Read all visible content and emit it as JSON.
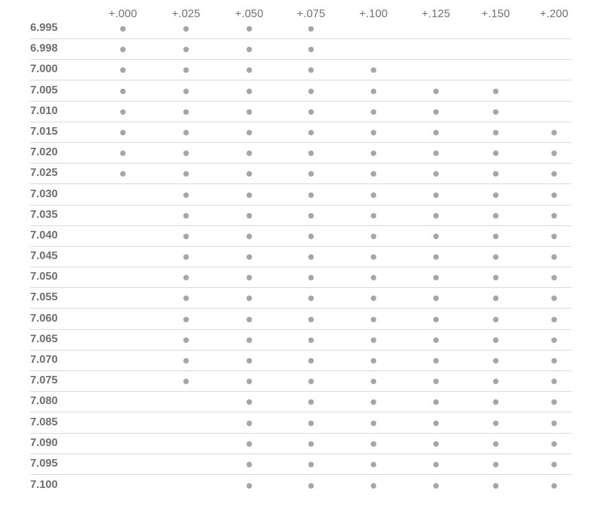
{
  "table": {
    "columns": [
      "+.000",
      "+.025",
      "+.050",
      "+.075",
      "+.100",
      "+.125",
      "+.150",
      "+.200"
    ],
    "dot_color": "#a6a6a6",
    "rows": [
      {
        "label": "6.995",
        "available": [
          true,
          true,
          true,
          true,
          false,
          false,
          false,
          false
        ]
      },
      {
        "label": "6.998",
        "available": [
          true,
          true,
          true,
          true,
          false,
          false,
          false,
          false
        ]
      },
      {
        "label": "7.000",
        "available": [
          true,
          true,
          true,
          true,
          true,
          false,
          false,
          false
        ]
      },
      {
        "label": "7.005",
        "available": [
          true,
          true,
          true,
          true,
          true,
          true,
          true,
          false
        ]
      },
      {
        "label": "7.010",
        "available": [
          true,
          true,
          true,
          true,
          true,
          true,
          true,
          false
        ]
      },
      {
        "label": "7.015",
        "available": [
          true,
          true,
          true,
          true,
          true,
          true,
          true,
          true
        ]
      },
      {
        "label": "7.020",
        "available": [
          true,
          true,
          true,
          true,
          true,
          true,
          true,
          true
        ]
      },
      {
        "label": "7.025",
        "available": [
          true,
          true,
          true,
          true,
          true,
          true,
          true,
          true
        ]
      },
      {
        "label": "7.030",
        "available": [
          false,
          true,
          true,
          true,
          true,
          true,
          true,
          true
        ]
      },
      {
        "label": "7.035",
        "available": [
          false,
          true,
          true,
          true,
          true,
          true,
          true,
          true
        ]
      },
      {
        "label": "7.040",
        "available": [
          false,
          true,
          true,
          true,
          true,
          true,
          true,
          true
        ]
      },
      {
        "label": "7.045",
        "available": [
          false,
          true,
          true,
          true,
          true,
          true,
          true,
          true
        ]
      },
      {
        "label": "7.050",
        "available": [
          false,
          true,
          true,
          true,
          true,
          true,
          true,
          true
        ]
      },
      {
        "label": "7.055",
        "available": [
          false,
          true,
          true,
          true,
          true,
          true,
          true,
          true
        ]
      },
      {
        "label": "7.060",
        "available": [
          false,
          true,
          true,
          true,
          true,
          true,
          true,
          true
        ]
      },
      {
        "label": "7.065",
        "available": [
          false,
          true,
          true,
          true,
          true,
          true,
          true,
          true
        ]
      },
      {
        "label": "7.070",
        "available": [
          false,
          true,
          true,
          true,
          true,
          true,
          true,
          true
        ]
      },
      {
        "label": "7.075",
        "available": [
          false,
          true,
          true,
          true,
          true,
          true,
          true,
          true
        ]
      },
      {
        "label": "7.080",
        "available": [
          false,
          false,
          true,
          true,
          true,
          true,
          true,
          true
        ]
      },
      {
        "label": "7.085",
        "available": [
          false,
          false,
          true,
          true,
          true,
          true,
          true,
          true
        ]
      },
      {
        "label": "7.090",
        "available": [
          false,
          false,
          true,
          true,
          true,
          true,
          true,
          true
        ]
      },
      {
        "label": "7.095",
        "available": [
          false,
          false,
          true,
          true,
          true,
          true,
          true,
          true
        ]
      },
      {
        "label": "7.100",
        "available": [
          false,
          false,
          true,
          true,
          true,
          true,
          true,
          true
        ]
      }
    ]
  }
}
